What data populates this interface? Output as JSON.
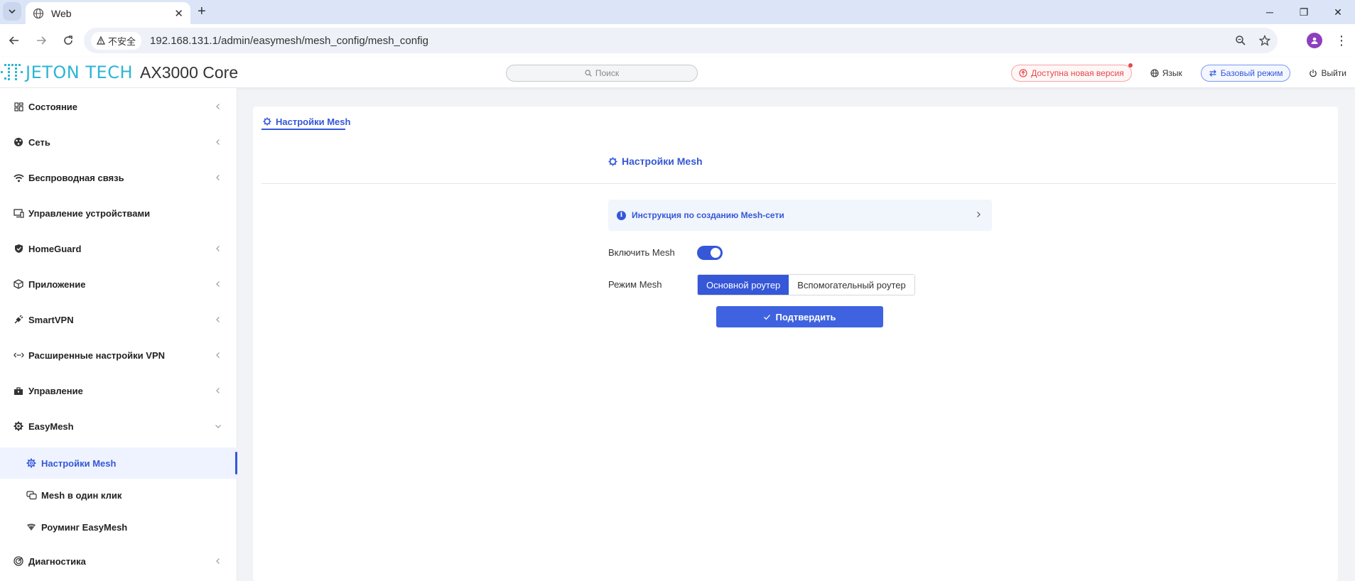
{
  "browser": {
    "tab_title": "Web",
    "security_label": "不安全",
    "url": "192.168.131.1/admin/easymesh/mesh_config/mesh_config"
  },
  "header": {
    "logo_text": "JETON TECH",
    "model": "AX3000 Core",
    "search_placeholder": "Поиск",
    "update_label": "Доступна новая версия",
    "language_label": "Язык",
    "mode_label": "Базовый режим",
    "logout_label": "Выйти"
  },
  "sidebar": {
    "items": [
      {
        "label": "Состояние"
      },
      {
        "label": "Сеть"
      },
      {
        "label": "Беспроводная связь"
      },
      {
        "label": "Управление устройствами"
      },
      {
        "label": "HomeGuard"
      },
      {
        "label": "Приложение"
      },
      {
        "label": "SmartVPN"
      },
      {
        "label": "Расширенные настройки VPN"
      },
      {
        "label": "Управление"
      },
      {
        "label": "EasyMesh"
      },
      {
        "label": "Диагностика"
      }
    ],
    "subitems": [
      {
        "label": "Настройки Mesh"
      },
      {
        "label": "Mesh в один клик"
      },
      {
        "label": "Роуминг EasyMesh"
      }
    ]
  },
  "main": {
    "tab_label": "Настройки Mesh",
    "section_title": "Настройки Mesh",
    "notice_text": "Инструкция по созданию Mesh-сети",
    "enable_label": "Включить Mesh",
    "mode_label": "Режим Mesh",
    "mode_options": [
      "Основной роутер",
      "Вспомогательный роутер"
    ],
    "mode_selected": "Основной роутер",
    "enabled": true,
    "confirm_label": "Подтвердить"
  },
  "colors": {
    "accent": "#3557d8",
    "update_red": "#e5484d",
    "logo_teal": "#2cb5d6"
  }
}
